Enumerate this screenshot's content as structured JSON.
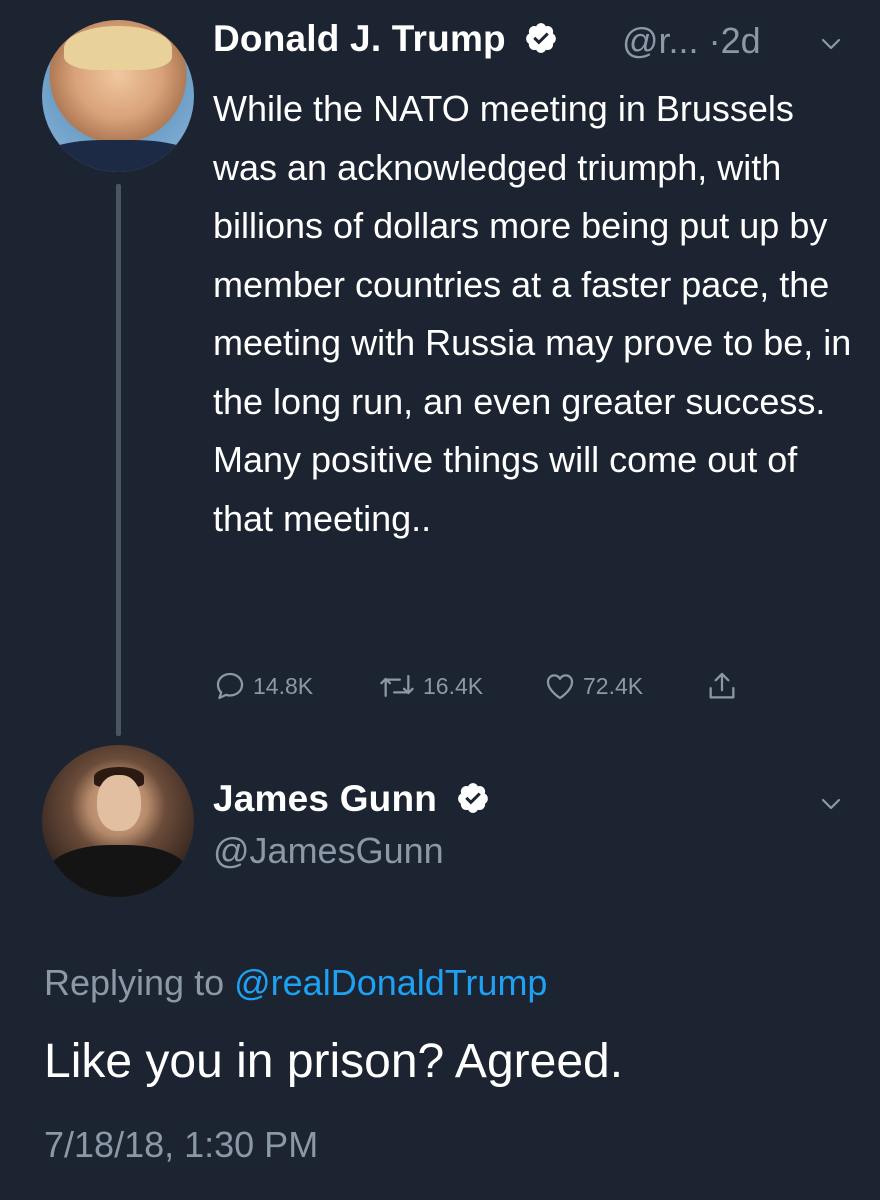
{
  "original_tweet": {
    "author_name": "Donald J. Trump",
    "author_handle_truncated": "@r...",
    "separator": "·",
    "age": "2d",
    "verified": true,
    "text": "While the NATO meeting in Brussels was an acknowledged triumph, with billions of dollars more being put up by member countries at a faster pace, the meeting with Russia may prove to be, in the long run, an even greater success. Many positive things will come out of that meeting..",
    "stats": {
      "replies": "14.8K",
      "retweets": "16.4K",
      "likes": "72.4K"
    }
  },
  "reply_tweet": {
    "author_name": "James Gunn",
    "author_handle": "@JamesGunn",
    "verified": true,
    "replying_prefix": "Replying to",
    "replying_to": "@realDonaldTrump",
    "text": "Like you in prison? Agreed.",
    "timestamp": "7/18/18, 1:30 PM"
  },
  "colors": {
    "background": "#1c2331",
    "text_primary": "#ffffff",
    "text_secondary": "#8b98a5",
    "link": "#1da1f2",
    "thread_line": "#4a5563"
  },
  "icons": [
    "verified-badge-icon",
    "chevron-down-icon",
    "reply-icon",
    "retweet-icon",
    "like-icon",
    "share-icon"
  ]
}
